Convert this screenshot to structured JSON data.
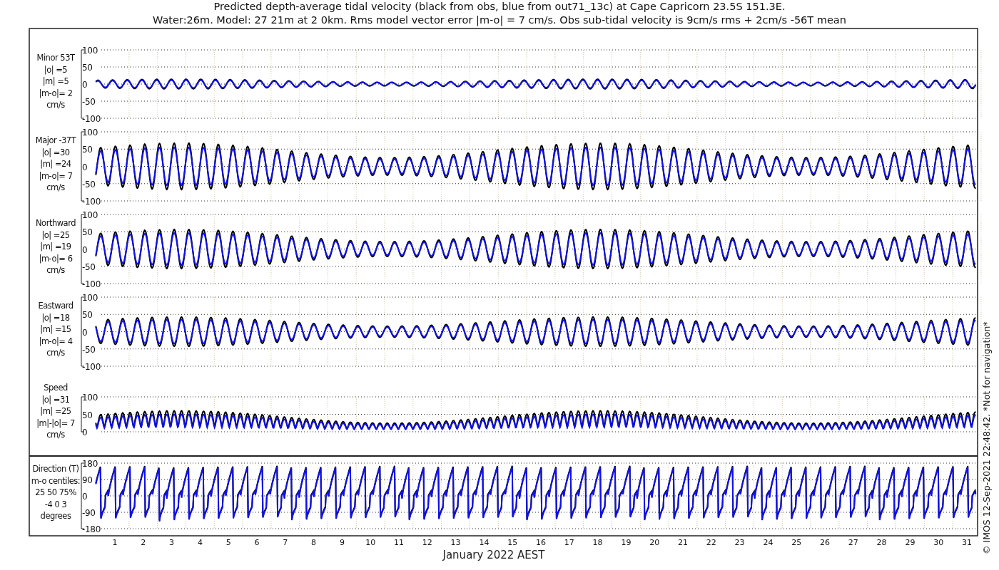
{
  "title": [
    "Predicted depth-average tidal velocity (black from obs, blue from out71_13c) at Cape Capricorn 23.5S 151.3E.",
    "Water:26m. Model: 27 21m at 2 0km. Rms model vector error |m-o| = 7 cm/s. Obs sub-tidal velocity is 9cm/s rms + 2cm/s -56T mean"
  ],
  "panels": [
    {
      "kind": "minor",
      "label": [
        "Minor 53T",
        "|o| =5",
        "|m| =5",
        "|m-o|= 2",
        "cm/s"
      ],
      "yticks": [
        "100",
        "50",
        "0",
        "-50",
        "-100"
      ]
    },
    {
      "kind": "major",
      "label": [
        "Major -37T",
        "|o| =30",
        "|m| =24",
        "|m-o|= 7",
        "cm/s"
      ],
      "yticks": [
        "100",
        "50",
        "0",
        "-50",
        "-100"
      ]
    },
    {
      "kind": "northward",
      "label": [
        "Northward",
        "|o| =25",
        "|m| =19",
        "|m-o|= 6",
        "cm/s"
      ],
      "yticks": [
        "100",
        "50",
        "0",
        "-50",
        "-100"
      ]
    },
    {
      "kind": "eastward",
      "label": [
        "Eastward",
        "|o| =18",
        "|m| =15",
        "|m-o|= 4",
        "cm/s"
      ],
      "yticks": [
        "100",
        "50",
        "0",
        "-50",
        "-100"
      ]
    },
    {
      "kind": "speed",
      "label": [
        "Speed",
        "|o| =31",
        "|m| =25",
        "|m|-|o|= 7",
        "cm/s"
      ],
      "yticks": [
        "100",
        "50",
        "0"
      ]
    },
    {
      "kind": "direction",
      "label": [
        "Direction (T)",
        "m-o centiles:",
        "25  50  75%",
        "-4  0  3",
        "degrees"
      ],
      "yticks": [
        "180",
        "90",
        "0",
        "-90",
        "-180"
      ]
    }
  ],
  "xticks": [
    "1",
    "2",
    "3",
    "4",
    "5",
    "6",
    "7",
    "8",
    "9",
    "10",
    "11",
    "12",
    "13",
    "14",
    "15",
    "16",
    "17",
    "18",
    "19",
    "20",
    "21",
    "22",
    "23",
    "24",
    "25",
    "26",
    "27",
    "28",
    "29",
    "30",
    "31"
  ],
  "xlabel": "January 2022 AEST",
  "side_note": "© IMOS 12-Sep-2021 22:48:42. *Not for navigation*"
}
